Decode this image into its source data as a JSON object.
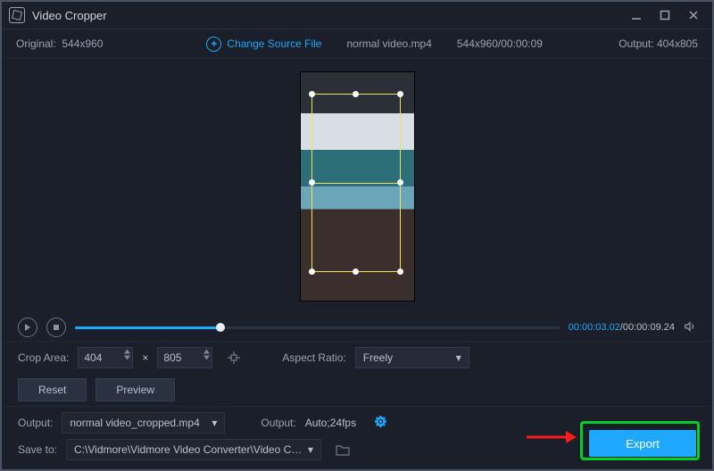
{
  "titlebar": {
    "title": "Video Cropper"
  },
  "infobar": {
    "original_label": "Original:",
    "original_dims": "544x960",
    "change_source": "Change Source File",
    "filename": "normal video.mp4",
    "file_info": "544x960/00:00:09",
    "output_label": "Output:",
    "output_dims": "404x805"
  },
  "playback": {
    "current_time": "00:00:03.02",
    "total_time": "/00:00:09.24"
  },
  "crop": {
    "area_label": "Crop Area:",
    "width": "404",
    "height": "805",
    "times": "×",
    "aspect_label": "Aspect Ratio:",
    "aspect_value": "Freely"
  },
  "buttons": {
    "reset": "Reset",
    "preview": "Preview",
    "export": "Export"
  },
  "output": {
    "label1": "Output:",
    "filename": "normal video_cropped.mp4",
    "label2": "Output:",
    "settings": "Auto;24fps",
    "save_label": "Save to:",
    "save_path": "C:\\Vidmore\\Vidmore Video Converter\\Video Crop"
  }
}
